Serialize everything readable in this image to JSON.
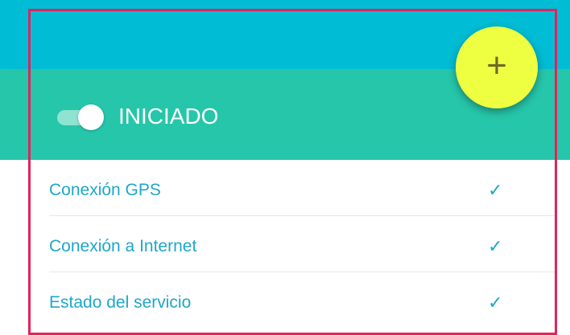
{
  "status": {
    "label": "INICIADO",
    "toggle_on": true
  },
  "fab": {
    "icon": "add-icon",
    "glyph": "+"
  },
  "checks": [
    {
      "label": "Conexión GPS",
      "icon": "check-icon",
      "glyph": "✓"
    },
    {
      "label": "Conexión a Internet",
      "icon": "check-icon",
      "glyph": "✓"
    },
    {
      "label": "Estado del servicio",
      "icon": "check-icon",
      "glyph": "✓"
    }
  ],
  "colors": {
    "appbar": "#00bcd4",
    "status_panel": "#26c6aa",
    "fab": "#eeff41",
    "accent_text": "#1ea7c9",
    "highlight_frame": "#e0245e"
  }
}
